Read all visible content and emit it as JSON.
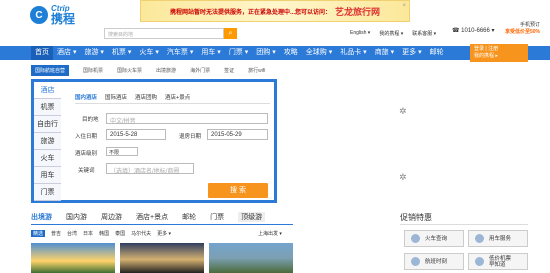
{
  "banner": {
    "text": "携程网站暂时无法提供服务，正在紧急处理中...您可以访问：",
    "link": "艺龙旅行网",
    "close": "×"
  },
  "logo": {
    "en": "Ctrip",
    "cn": "携程",
    "mark": "C"
  },
  "search": {
    "placeholder": "搜索目的地",
    "button": "⌕"
  },
  "toplinks": [
    "English ▾",
    "我的携程 ▾",
    "联系客服 ▾"
  ],
  "phone": "☎ 1010-6666 ▾",
  "app": {
    "l1": "手机预订",
    "l2": "享受低价至50%"
  },
  "nav": [
    "首页",
    "酒店 ▾",
    "旅游 ▾",
    "机票 ▾",
    "火车 ▾",
    "汽车票 ▾",
    "用车 ▾",
    "门票 ▾",
    "团购 ▾",
    "攻略",
    "全球购 ▾",
    "礼品卡 ▾",
    "商旅 ▾",
    "更多 ▾",
    "邮轮"
  ],
  "login": {
    "l1": "登录 | 注册",
    "l2": "我的携程 ▸"
  },
  "subnav": [
    "国际航班自营",
    "国际机票",
    "国际火车票",
    "出境旅游",
    "海外门票",
    "签证",
    "旅行wifi"
  ],
  "sidebar": [
    "酒店",
    "机票",
    "自由行",
    "旅游",
    "火车",
    "用车",
    "门票"
  ],
  "tabs": [
    "国内酒店",
    "国际酒店",
    "酒店团购",
    "酒店+景点"
  ],
  "form": {
    "dest_label": "目的地",
    "dest_placeholder": "中文/拼音",
    "checkin_label": "入住日期",
    "checkin_value": "2015-5-28",
    "checkout_label": "退房日期",
    "checkout_value": "2015-05-29",
    "star_label": "酒店级别",
    "star_value": "不限",
    "keyword_label": "关键词",
    "keyword_placeholder": "（选填）酒店名/地标/商圈",
    "search_button": "搜 索"
  },
  "tourTabs": [
    "出境游",
    "国内游",
    "周边游",
    "酒店+景点",
    "邮轮",
    "门票",
    "顶级游"
  ],
  "destTabs": [
    "精选",
    "普吉",
    "台湾",
    "日本",
    "韩国",
    "泰国",
    "马尔代夫",
    "更多 ▾"
  ],
  "departure": "上海出发 ▾",
  "promo": {
    "title": "促销特惠",
    "buttons": [
      "火车查询",
      "用车服务",
      "航班时刻",
      "低价机票\n早知道"
    ]
  },
  "spinner": "✲"
}
